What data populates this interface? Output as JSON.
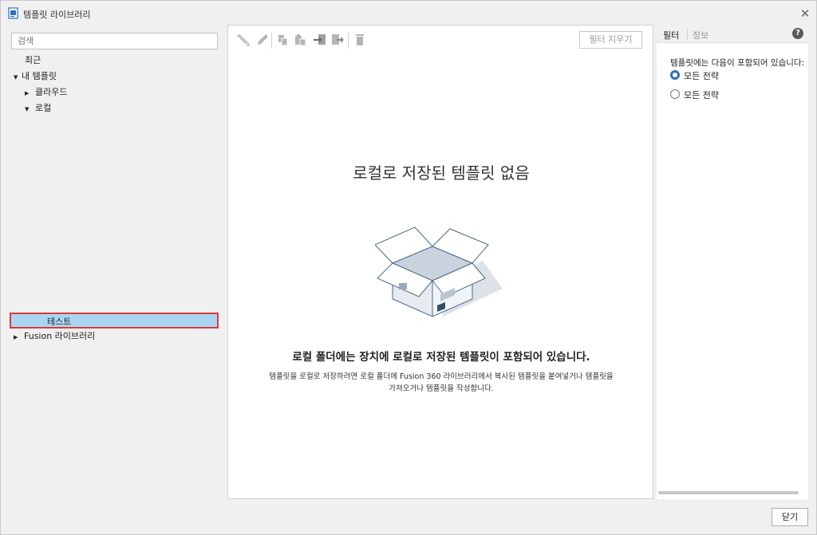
{
  "window": {
    "title": "템플릿 라이브러리",
    "close_glyph": "✕"
  },
  "sidebar": {
    "search_placeholder": "검색",
    "items": [
      {
        "label": "최근",
        "expander": ""
      },
      {
        "label": "내 템플릿",
        "expander": "▼"
      },
      {
        "label": "클라우드",
        "expander": "▶"
      },
      {
        "label": "로컬",
        "expander": "▼"
      },
      {
        "label": "테스트",
        "expander": "",
        "selected": true
      },
      {
        "label": "Fusion 라이브러리",
        "expander": "▶"
      }
    ]
  },
  "toolbar": {
    "icons": [
      "wand-icon",
      "edit-icon",
      "copy-icon",
      "paste-icon",
      "import-icon",
      "export-icon",
      "delete-icon"
    ],
    "clear_filter_label": "필터 지우기"
  },
  "main": {
    "empty_title": "로컬로 저장된 템플릿 없음",
    "empty_subtitle": "로컬 폴더에는 장치에 로컬로 저장된 템플릿이 포함되어 있습니다.",
    "empty_desc_line1": "템플릿을 로컬로 저장하려면 로컬 폴더에 Fusion 360 라이브러리에서 복사된 템플릿을 붙여넣거나 템플릿을",
    "empty_desc_line2": "가져오거나 템플릿을 작성합니다."
  },
  "filter_panel": {
    "tabs": [
      {
        "label": "필터",
        "active": true
      },
      {
        "label": "정보",
        "active": false
      }
    ],
    "help_glyph": "?",
    "description": "템플릿에는 다음이 포함되어 있습니다:",
    "options": [
      {
        "label": "모든 전략",
        "checked": true
      },
      {
        "label": "모든 전략",
        "checked": false
      }
    ]
  },
  "footer": {
    "close_label": "닫기"
  },
  "colors": {
    "accent": "#2b6fb8",
    "selection": "#aad6f2",
    "selection_border": "#d93a3a"
  }
}
